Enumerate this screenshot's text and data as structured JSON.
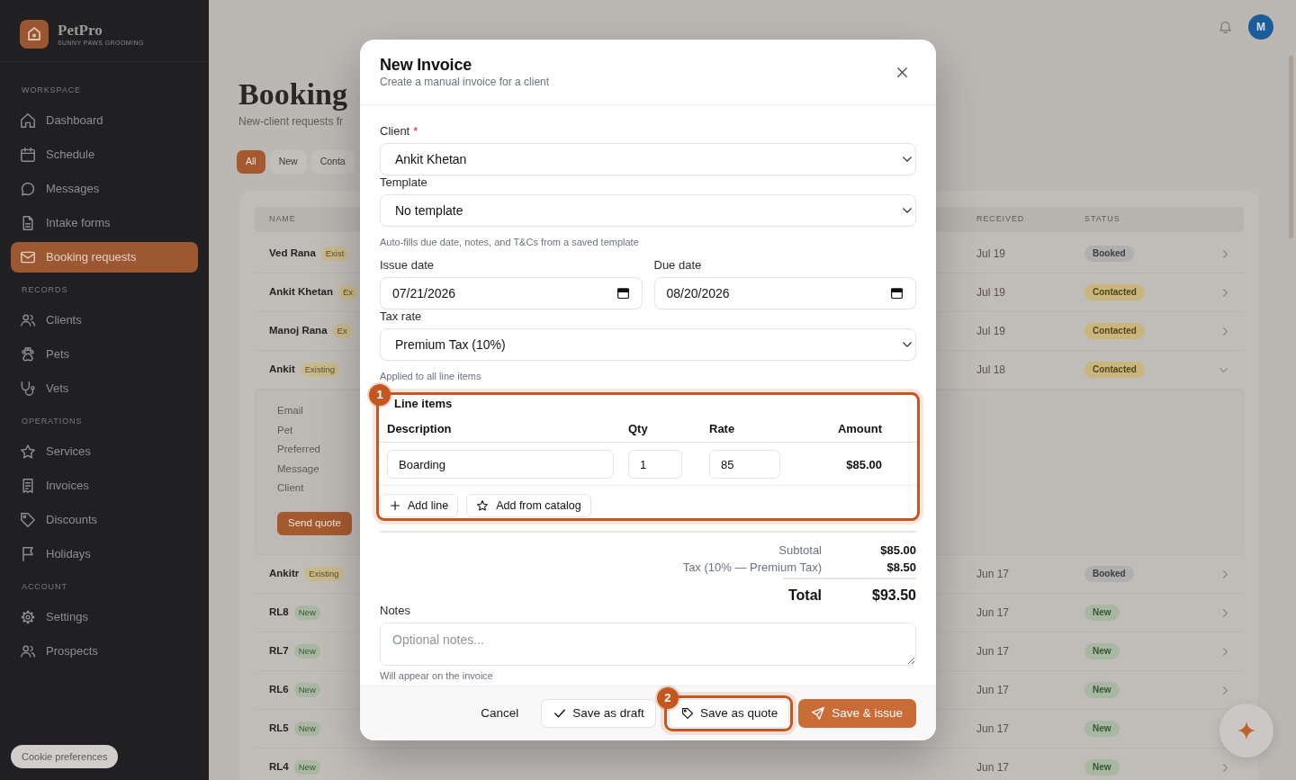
{
  "sidebar": {
    "brand": {
      "name": "PetPro",
      "tagline": "SUNNY PAWS GROOMING"
    },
    "sections": [
      {
        "heading": "WORKSPACE",
        "items": [
          {
            "label": "Dashboard",
            "selected": false
          },
          {
            "label": "Schedule",
            "selected": false
          },
          {
            "label": "Messages",
            "selected": false
          },
          {
            "label": "Intake forms",
            "selected": false
          },
          {
            "label": "Booking requests",
            "selected": true
          }
        ]
      },
      {
        "heading": "RECORDS",
        "items": [
          {
            "label": "Clients",
            "selected": false
          },
          {
            "label": "Pets",
            "selected": false
          },
          {
            "label": "Vets",
            "selected": false
          }
        ]
      },
      {
        "heading": "OPERATIONS",
        "items": [
          {
            "label": "Services",
            "selected": false
          },
          {
            "label": "Invoices",
            "selected": false
          },
          {
            "label": "Discounts",
            "selected": false
          },
          {
            "label": "Holidays",
            "selected": false
          }
        ]
      },
      {
        "heading": "ACCOUNT",
        "items": [
          {
            "label": "Settings",
            "selected": false
          },
          {
            "label": "Prospects",
            "selected": false
          }
        ]
      }
    ],
    "cookie_button": "Cookie preferences"
  },
  "topbar": {
    "avatar": "M"
  },
  "page": {
    "title": "Booking",
    "subtitle": "New-client requests fr",
    "filters": [
      {
        "label": "All",
        "selected": true
      },
      {
        "label": "New",
        "selected": false
      },
      {
        "label": "Conta",
        "selected": false
      }
    ],
    "table": {
      "columns": [
        "NAME",
        "RECEIVED",
        "STATUS"
      ],
      "rows": [
        {
          "name": "Ved Rana",
          "tag": {
            "label": "Exist",
            "kind": "existing"
          },
          "received": "Jul 19",
          "status": {
            "label": "Booked",
            "kind": "booked"
          },
          "expanded": false
        },
        {
          "name": "Ankit Khetan",
          "tag": {
            "label": "Ex",
            "kind": "existing"
          },
          "received": "Jul 19",
          "status": {
            "label": "Contacted",
            "kind": "contacted"
          },
          "expanded": false
        },
        {
          "name": "Manoj Rana",
          "tag": {
            "label": "Ex",
            "kind": "existing"
          },
          "received": "Jul 19",
          "status": {
            "label": "Contacted",
            "kind": "contacted"
          },
          "expanded": false
        },
        {
          "name": "Ankit",
          "tag": {
            "label": "Existing",
            "kind": "existing"
          },
          "received": "Jul 18",
          "status": {
            "label": "Contacted",
            "kind": "contacted"
          },
          "expanded": true,
          "details": {
            "fields": [
              "Email",
              "Pet",
              "Preferred",
              "Message",
              "Client"
            ],
            "action": "Send quote"
          }
        },
        {
          "name": "Ankitr",
          "tag": {
            "label": "Existing",
            "kind": "existing"
          },
          "received": "Jun 17",
          "status": {
            "label": "Booked",
            "kind": "booked"
          },
          "expanded": false
        },
        {
          "name": "RL8",
          "tag": {
            "label": "New",
            "kind": "new"
          },
          "received": "Jun 17",
          "status": {
            "label": "New",
            "kind": "new"
          },
          "expanded": false
        },
        {
          "name": "RL7",
          "tag": {
            "label": "New",
            "kind": "new"
          },
          "received": "Jun 17",
          "status": {
            "label": "New",
            "kind": "new"
          },
          "expanded": false
        },
        {
          "name": "RL6",
          "tag": {
            "label": "New",
            "kind": "new"
          },
          "received": "Jun 17",
          "status": {
            "label": "New",
            "kind": "new"
          },
          "expanded": false
        },
        {
          "name": "RL5",
          "tag": {
            "label": "New",
            "kind": "new"
          },
          "received": "Jun 17",
          "status": {
            "label": "New",
            "kind": "new"
          },
          "expanded": false
        },
        {
          "name": "RL4",
          "tag": {
            "label": "New",
            "kind": "new"
          },
          "received": "Jun 17",
          "status": {
            "label": "New",
            "kind": "new"
          },
          "expanded": false
        }
      ]
    }
  },
  "modal": {
    "title": "New Invoice",
    "subtitle": "Create a manual invoice for a client",
    "client": {
      "label": "Client",
      "required_mark": "*",
      "value": "Ankit Khetan"
    },
    "template": {
      "label": "Template",
      "value": "No template",
      "help": "Auto-fills due date, notes, and T&Cs from a saved template"
    },
    "issue_date": {
      "label": "Issue date",
      "value": "07/21/2026"
    },
    "due_date": {
      "label": "Due date",
      "value": "08/20/2026"
    },
    "tax_rate": {
      "label": "Tax rate",
      "value": "Premium Tax (10%)",
      "help": "Applied to all line items"
    },
    "line_items": {
      "title": "Line items",
      "callout": "1",
      "columns": [
        "Description",
        "Qty",
        "Rate",
        "Amount"
      ],
      "rows": [
        {
          "description": "Boarding",
          "qty": "1",
          "rate": "85",
          "amount": "$85.00"
        }
      ],
      "actions": [
        "Add line",
        "Add from catalog"
      ]
    },
    "totals": [
      {
        "label": "Subtotal",
        "value": "$85.00",
        "kind": "line"
      },
      {
        "label": "Tax (10% — Premium Tax)",
        "value": "$8.50",
        "kind": "line"
      },
      {
        "label": "Total",
        "value": "$93.50",
        "kind": "grand"
      }
    ],
    "notes": {
      "label": "Notes",
      "placeholder": "Optional notes...",
      "help": "Will appear on the invoice"
    },
    "buttons": [
      {
        "label": "Cancel",
        "kind": "link"
      },
      {
        "label": "Save as draft",
        "kind": "outline"
      },
      {
        "label": "Save as quote",
        "kind": "outline",
        "callout": "2"
      },
      {
        "label": "Save & issue",
        "kind": "primary"
      }
    ]
  }
}
